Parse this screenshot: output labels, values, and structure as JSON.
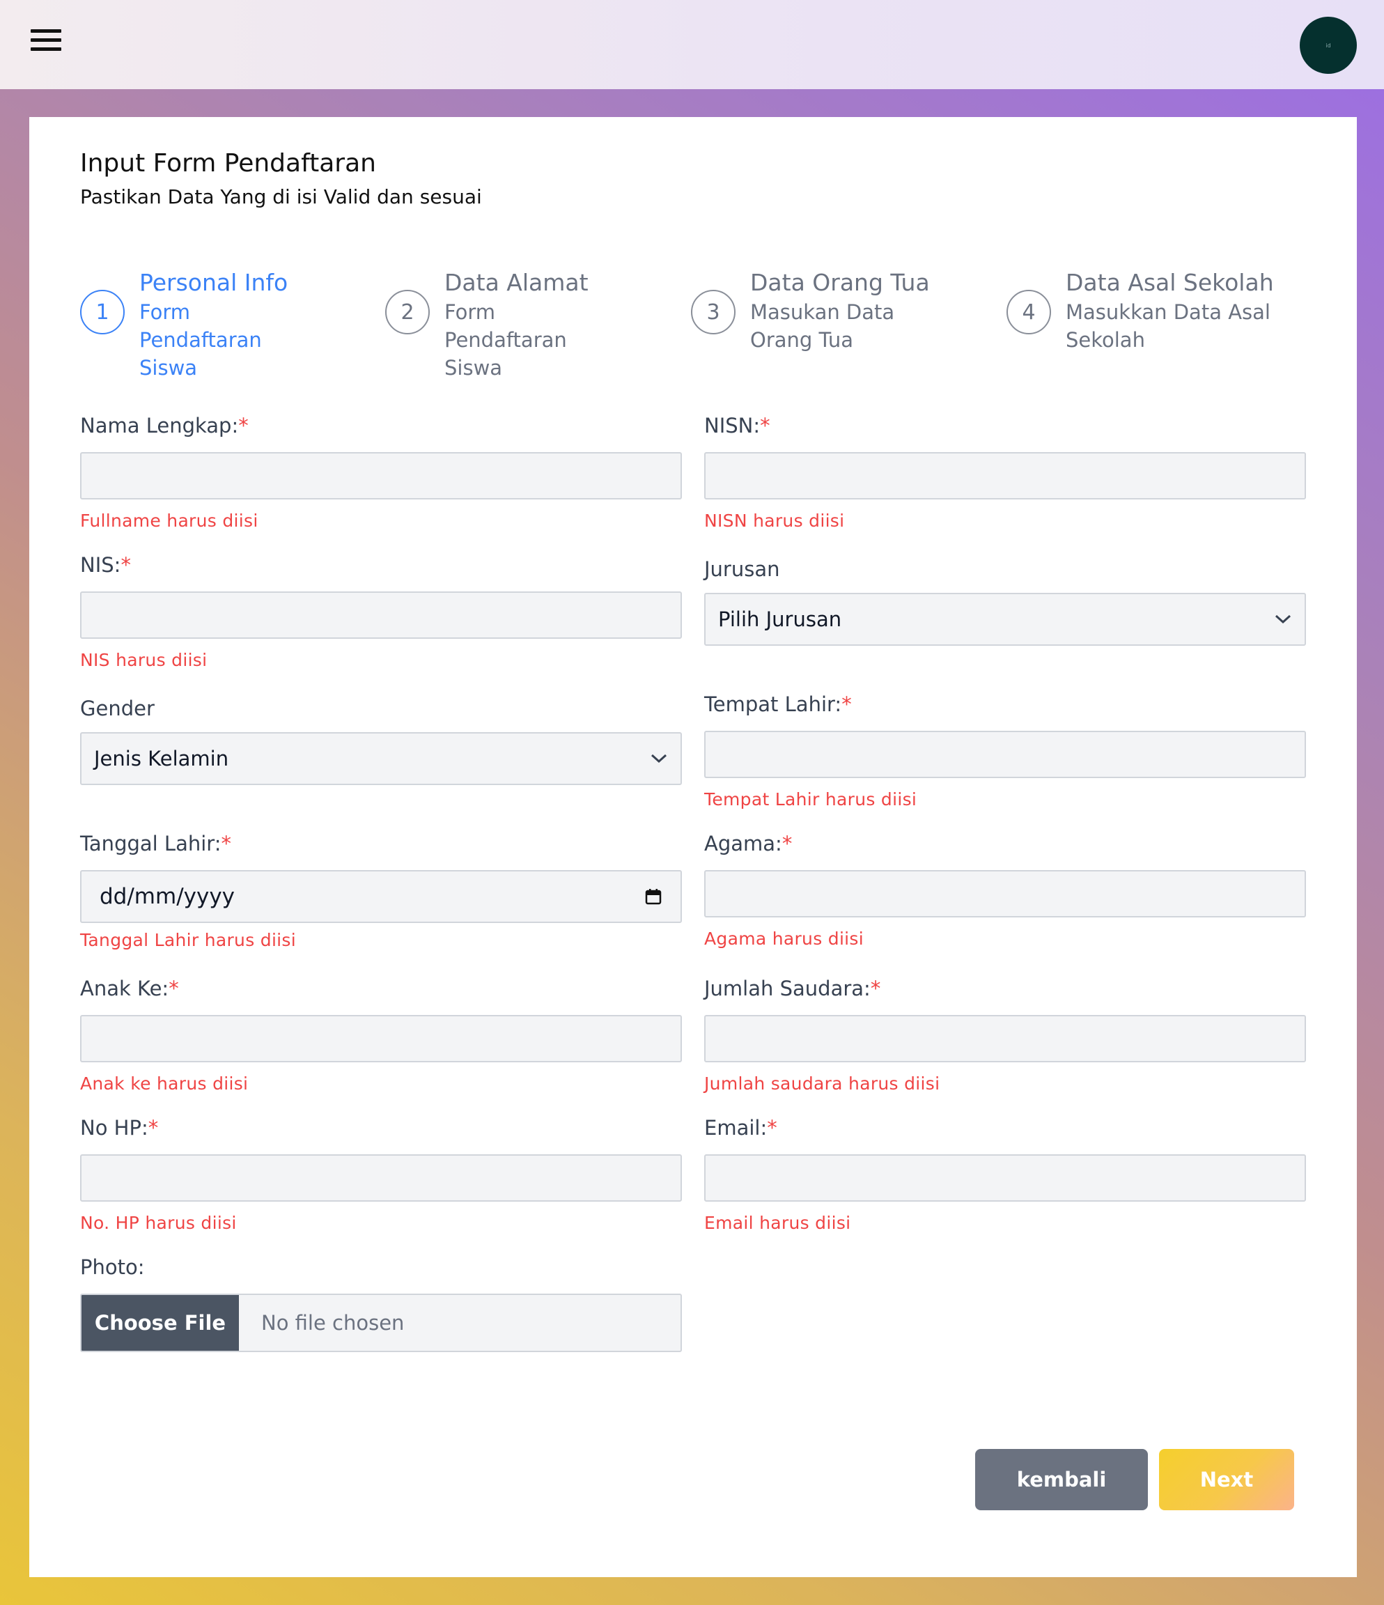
{
  "header": {
    "menu_icon": "hamburger-menu-icon",
    "avatar_text": "id"
  },
  "form": {
    "title": "Input Form Pendaftaran",
    "subtitle": "Pastikan Data Yang di isi Valid dan sesuai"
  },
  "steps": [
    {
      "number": "1",
      "name": "Personal Info",
      "desc_line1": "Form Pendaftaran",
      "desc_line2": "Siswa",
      "active": true
    },
    {
      "number": "2",
      "name": "Data Alamat",
      "desc_line1": "Form Pendaftaran",
      "desc_line2": "Siswa",
      "active": false
    },
    {
      "number": "3",
      "name": "Data Orang Tua",
      "desc_line1": "Masukan Data",
      "desc_line2": "Orang Tua",
      "active": false
    },
    {
      "number": "4",
      "name": "Data Asal Sekolah",
      "desc_line1": "Masukkan Data Asal",
      "desc_line2": "Sekolah",
      "active": false
    }
  ],
  "fields": {
    "nama_lengkap": {
      "label": "Nama Lengkap:",
      "required": "*",
      "error": "Fullname harus diisi",
      "value": ""
    },
    "nisn": {
      "label": "NISN:",
      "required": "*",
      "error": "NISN harus diisi",
      "value": ""
    },
    "nis": {
      "label": "NIS:",
      "required": "*",
      "error": "NIS harus diisi",
      "value": ""
    },
    "jurusan": {
      "label": "Jurusan",
      "selected": "Pilih Jurusan"
    },
    "gender": {
      "label": "Gender",
      "selected": "Jenis Kelamin"
    },
    "tempat_lahir": {
      "label": "Tempat Lahir:",
      "required": "*",
      "error": "Tempat Lahir harus diisi",
      "value": ""
    },
    "tanggal_lahir": {
      "label": "Tanggal Lahir:",
      "required": "*",
      "placeholder": "dd/mm/yyyy",
      "error": "Tanggal Lahir harus diisi"
    },
    "agama": {
      "label": "Agama:",
      "required": "*",
      "error": "Agama harus diisi",
      "value": ""
    },
    "anak_ke": {
      "label": "Anak Ke:",
      "required": "*",
      "error": "Anak ke harus diisi",
      "value": ""
    },
    "jumlah_saudara": {
      "label": "Jumlah Saudara:",
      "required": "*",
      "error": "Jumlah saudara harus diisi",
      "value": ""
    },
    "no_hp": {
      "label": "No HP:",
      "required": "*",
      "error": "No. HP harus diisi",
      "value": ""
    },
    "email": {
      "label": "Email:",
      "required": "*",
      "error": "Email harus diisi",
      "value": ""
    },
    "photo": {
      "label": "Photo:",
      "button": "Choose File",
      "status": "No file chosen"
    }
  },
  "buttons": {
    "back": "kembali",
    "next": "Next"
  },
  "colors": {
    "active_step": "#3b82f6",
    "error": "#ef4444",
    "back_button": "#6b7280",
    "next_button": "#f5cf2d"
  }
}
